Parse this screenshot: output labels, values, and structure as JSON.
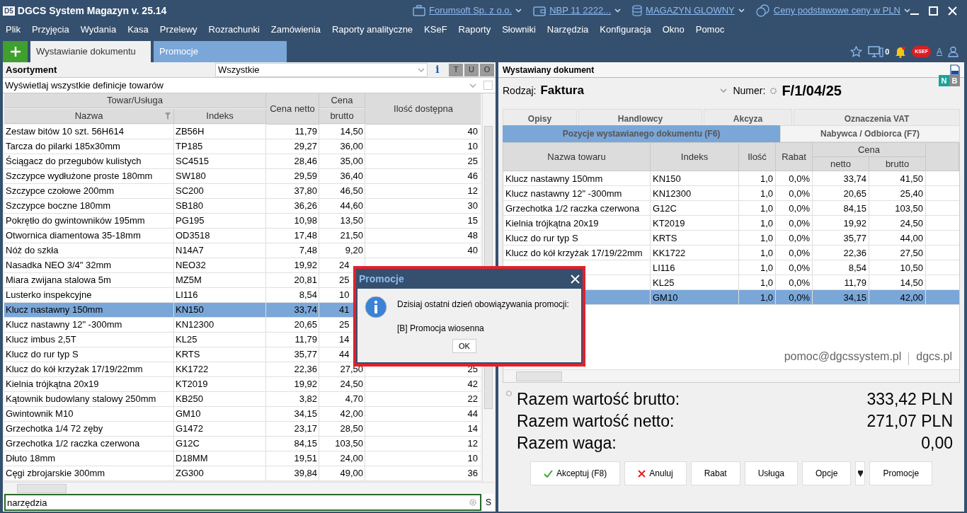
{
  "window": {
    "logo": "D5",
    "title": "DGCS System Magazyn v. 25.14",
    "context": [
      {
        "kind": "company",
        "label": "Forumsoft Sp. z o.o."
      },
      {
        "kind": "bank",
        "label": "NBP 11 2222..."
      },
      {
        "kind": "warehouse",
        "label": "MAGAZYN GLOWNY"
      },
      {
        "kind": "price",
        "label": "Ceny podstawowe ceny w PLN"
      }
    ]
  },
  "menu": [
    "Plik",
    "Przyjęcia",
    "Wydania",
    "Kasa",
    "Przelewy",
    "Rozrachunki",
    "Zamówienia",
    "Raporty analityczne",
    "KSeF",
    "Raporty",
    "Słowniki",
    "Narzędzia",
    "Konfiguracja",
    "Okno",
    "Pomoc"
  ],
  "tabs": [
    {
      "label": "Wystawianie dokumentu",
      "selected": true
    },
    {
      "label": "Promocje",
      "selected": false
    }
  ],
  "toolbar": {
    "monitor_count": "0",
    "ksef_badge": "KSEF",
    "font_label": "A"
  },
  "assortment": {
    "title": "Asortyment",
    "filter": "Wszystkie",
    "info": "i",
    "buttons": [
      "T",
      "U",
      "O"
    ],
    "definitions": "Wyświetlaj wszystkie definicje towarów",
    "definitions_checked": false,
    "group_headers": [
      "Towar/Usługa",
      "Cena"
    ],
    "columns": [
      "Nazwa",
      "Indeks",
      "Cena netto",
      "brutto",
      "Ilość dostępna"
    ],
    "rows": [
      {
        "name": "Zestaw bitów 10 szt. 56H614",
        "index": "ZB56H",
        "net": "11,79",
        "gross": "14,50",
        "qty": "40",
        "selected": false
      },
      {
        "name": "Tarcza do pilarki 185x30mm",
        "index": "TP185",
        "net": "29,27",
        "gross": "36,00",
        "qty": "10",
        "selected": false
      },
      {
        "name": "Ściągacz do przegubów kulistych",
        "index": "SC4515",
        "net": "28,46",
        "gross": "35,00",
        "qty": "25",
        "selected": false
      },
      {
        "name": "Szczypce wydłużone proste 180mm",
        "index": "SW180",
        "net": "29,59",
        "gross": "36,40",
        "qty": "46",
        "selected": false
      },
      {
        "name": "Szczypce czołowe 200mm",
        "index": "SC200",
        "net": "37,80",
        "gross": "46,50",
        "qty": "12",
        "selected": false
      },
      {
        "name": "Szczypce boczne 180mm",
        "index": "SB180",
        "net": "36,26",
        "gross": "44,60",
        "qty": "30",
        "selected": false
      },
      {
        "name": "Pokrętło do gwintowników 195mm",
        "index": "PG195",
        "net": "10,98",
        "gross": "13,50",
        "qty": "15",
        "selected": false
      },
      {
        "name": "Otwornica diamentowa 35-18mm",
        "index": "OD3518",
        "net": "17,48",
        "gross": "21,50",
        "qty": "48",
        "selected": false
      },
      {
        "name": "Nóż do szkła",
        "index": "N14A7",
        "net": "7,48",
        "gross": "9,20",
        "qty": "40",
        "selected": false
      },
      {
        "name": "Nasadka NEO 3/4\" 32mm",
        "index": "NEO32",
        "net": "19,92",
        "gross": "24",
        "gross_covered": true,
        "selected": false
      },
      {
        "name": "Miara zwijana stalowa 5m",
        "index": "MZ5M",
        "net": "20,81",
        "gross": "25",
        "gross_covered": true,
        "selected": false
      },
      {
        "name": "Lusterko inspekcyjne",
        "index": "LI116",
        "net": "8,54",
        "gross": "10",
        "gross_covered": true,
        "selected": false
      },
      {
        "name": "Klucz nastawny 150mm",
        "index": "KN150",
        "net": "33,74",
        "gross": "41",
        "gross_covered": true,
        "selected": true
      },
      {
        "name": "Klucz nastawny 12\" -300mm",
        "index": "KN12300",
        "net": "20,65",
        "gross": "25",
        "gross_covered": true,
        "selected": false
      },
      {
        "name": "Klucz imbus 2,5T",
        "index": "KL25",
        "net": "11,79",
        "gross": "14",
        "gross_covered": true,
        "selected": false
      },
      {
        "name": "Klucz do rur typ S",
        "index": "KRTS",
        "net": "35,77",
        "gross": "44",
        "gross_covered": true,
        "selected": false
      },
      {
        "name": "Klucz do kół krzyżak 17/19/22mm",
        "index": "KK1722",
        "net": "22,36",
        "gross": "27,50",
        "qty": "25",
        "selected": false
      },
      {
        "name": "Kielnia trójkątna 20x19",
        "index": "KT2019",
        "net": "19,92",
        "gross": "24,50",
        "qty": "42",
        "selected": false
      },
      {
        "name": "Kątownik budowlany stalowy 250mm",
        "index": "KB250",
        "net": "3,82",
        "gross": "4,70",
        "qty": "22",
        "selected": false
      },
      {
        "name": "Gwintownik M10",
        "index": "GM10",
        "net": "34,15",
        "gross": "42,00",
        "qty": "44",
        "selected": false
      },
      {
        "name": "Grzechotka 1/4 72 zęby",
        "index": "G1472",
        "net": "23,17",
        "gross": "28,50",
        "qty": "14",
        "selected": false
      },
      {
        "name": "Grzechotka 1/2 raczka czerwona",
        "index": "G12C",
        "net": "84,15",
        "gross": "103,50",
        "qty": "12",
        "selected": false
      },
      {
        "name": "Dłuto 18mm",
        "index": "D18MM",
        "net": "19,51",
        "gross": "24,00",
        "qty": "10",
        "selected": false
      },
      {
        "name": "Cęgi zbrojarskie 300mm",
        "index": "ZG300",
        "net": "39,84",
        "gross": "49,00",
        "qty": "36",
        "selected": false
      }
    ],
    "search": {
      "value": "narzędzia",
      "side_button": "S"
    }
  },
  "document": {
    "title": "Wystawiany dokument",
    "type_label": "Rodzaj:",
    "type": "Faktura",
    "number_label": "Numer:",
    "number": "F/1/04/25",
    "badges": [
      {
        "label": "N",
        "color": "#1aa39a"
      },
      {
        "label": "B",
        "color": "#8a8a8a"
      }
    ],
    "upper_tabs": [
      "Opisy",
      "Handlowcy",
      "Akcyza",
      "Oznaczenia VAT"
    ],
    "lower_tabs": [
      {
        "label": "Pozycje wystawianego dokumentu (F6)",
        "selected": true
      },
      {
        "label": "Nabywca / Odbiorca (F7)",
        "selected": false
      }
    ],
    "columns": [
      "Nazwa towaru",
      "Indeks",
      "Ilość",
      "Rabat",
      "netto",
      "brutto"
    ],
    "group_header": "Cena",
    "rows": [
      {
        "name": "Klucz nastawny 150mm",
        "index": "KN150",
        "qty": "1,0",
        "discount": "0,0%",
        "net": "33,74",
        "gross": "41,50",
        "selected": false
      },
      {
        "name": "Klucz nastawny 12\" -300mm",
        "index": "KN12300",
        "qty": "1,0",
        "discount": "0,0%",
        "net": "20,65",
        "gross": "25,40",
        "selected": false
      },
      {
        "name": "Grzechotka 1/2 raczka czerwona",
        "index": "G12C",
        "qty": "1,0",
        "discount": "0,0%",
        "net": "84,15",
        "gross": "103,50",
        "selected": false
      },
      {
        "name": "Kielnia trójkątna 20x19",
        "index": "KT2019",
        "qty": "1,0",
        "discount": "0,0%",
        "net": "19,92",
        "gross": "24,50",
        "selected": false
      },
      {
        "name": "Klucz do rur typ S",
        "index": "KRTS",
        "qty": "1,0",
        "discount": "0,0%",
        "net": "35,77",
        "gross": "44,00",
        "selected": false
      },
      {
        "name": "Klucz do kół krzyżak 17/19/22mm",
        "index": "KK1722",
        "qty": "1,0",
        "discount": "0,0%",
        "net": "22,36",
        "gross": "27,50",
        "selected": false
      },
      {
        "index": "LI116",
        "qty": "1,0",
        "discount": "0,0%",
        "net": "8,54",
        "gross": "10,50",
        "selected": false
      },
      {
        "index": "KL25",
        "qty": "1,0",
        "discount": "0,0%",
        "net": "11,79",
        "gross": "14,50",
        "selected": false
      },
      {
        "index": "GM10",
        "qty": "1,0",
        "discount": "0,0%",
        "net": "34,15",
        "gross": "42,00",
        "selected": true
      }
    ],
    "footer_links": [
      "pomoc@dgcssystem.pl",
      "dgcs.pl"
    ],
    "totals": [
      {
        "label": "Razem wartość brutto:",
        "value": "333,42 PLN"
      },
      {
        "label": "Razem wartość netto:",
        "value": "271,07 PLN"
      },
      {
        "label": "Razem waga:",
        "value": "0,00"
      }
    ],
    "buttons": [
      {
        "kind": "accept",
        "label": "Akceptuj (F8)"
      },
      {
        "kind": "cancel",
        "label": "Anuluj"
      },
      {
        "kind": "plain",
        "label": "Rabat"
      },
      {
        "kind": "plain",
        "label": "Usługa"
      },
      {
        "kind": "plain",
        "label": "Opcje"
      },
      {
        "kind": "dropdown"
      },
      {
        "kind": "plain",
        "label": "Promocje"
      }
    ]
  },
  "dialog": {
    "title": "Promocje",
    "message": "Dzisiaj ostatni dzień obowiązywania promocji:",
    "detail": "[B] Promocja wiosenna",
    "button": "OK"
  }
}
